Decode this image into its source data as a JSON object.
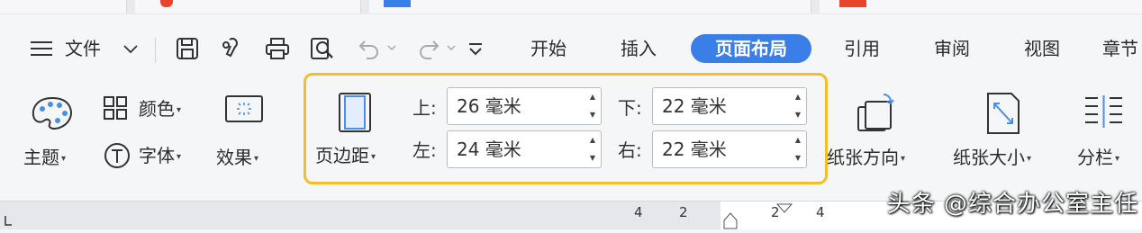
{
  "menu": {
    "file_label": "文件",
    "tabs": [
      {
        "label": "开始",
        "active": false
      },
      {
        "label": "插入",
        "active": false
      },
      {
        "label": "页面布局",
        "active": true
      },
      {
        "label": "引用",
        "active": false
      },
      {
        "label": "审阅",
        "active": false
      },
      {
        "label": "视图",
        "active": false
      },
      {
        "label": "章节",
        "active": false
      }
    ]
  },
  "ribbon": {
    "theme_label": "主题",
    "color_label": "颜色",
    "font_label": "字体",
    "effect_label": "效果",
    "margins_label": "页边距",
    "margins": {
      "top_label": "上:",
      "top_value": "26 毫米",
      "bottom_label": "下:",
      "bottom_value": "22 毫米",
      "left_label": "左:",
      "left_value": "24 毫米",
      "right_label": "右:",
      "right_value": "22 毫米"
    },
    "orientation_label": "纸张方向",
    "size_label": "纸张大小",
    "columns_label": "分栏"
  },
  "ruler": {
    "ticks": [
      "4",
      "2",
      "2",
      "4"
    ]
  },
  "watermark": "头条 @综合办公室主任",
  "colors": {
    "accent": "#3a7ee8",
    "highlight": "#f2bf2a"
  }
}
